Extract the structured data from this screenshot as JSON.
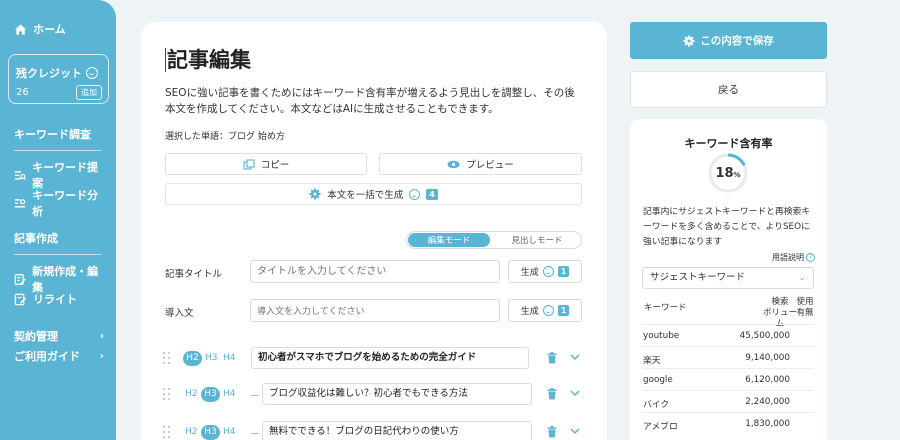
{
  "sidebar": {
    "home": "ホーム",
    "credit_title": "残クレジット",
    "credit_value": "26",
    "add_label": "追加",
    "section_keyword": "キーワード調査",
    "keyword_suggest": "キーワード提案",
    "keyword_analysis": "キーワード分析",
    "section_article": "記事作成",
    "new_edit": "新規作成・編集",
    "rewrite": "リライト",
    "contract": "契約管理",
    "guide": "ご利用ガイド"
  },
  "editor": {
    "title": "記事編集",
    "description": "SEOに強い記事を書くためにはキーワード含有率が増えるよう見出しを調整し、その後本文を作成してください。本文などはAIに生成させることもできます。",
    "selected_words": "選択した単語：ブログ 始め方",
    "copy_label": "コピー",
    "preview_label": "プレビュー",
    "generate_all_label": "本文を一括で生成",
    "generate_all_badge": "4",
    "mode_edit": "編集モード",
    "mode_heading": "見出しモード",
    "title_label": "記事タイトル",
    "title_placeholder": "タイトルを入力してください",
    "intro_label": "導入文",
    "intro_placeholder": "導入文を入力してください",
    "generate_label": "生成",
    "generate_badge": "1",
    "headings": [
      {
        "active": "H2",
        "text": "初心者がスマホでブログを始めるための完全ガイド"
      },
      {
        "active": "H3",
        "text": "ブログ収益化は難しい？初心者でもできる方法"
      },
      {
        "active": "H3",
        "text": "無料でできる！ブログの日記代わりの使い方"
      }
    ],
    "levels": [
      "H2",
      "H3",
      "H4"
    ]
  },
  "right": {
    "save_label": "この内容で保存",
    "back_label": "戻る",
    "panel_title": "キーワード含有率",
    "rate_value": "18",
    "rate_unit": "%",
    "rate_fraction": 0.18,
    "panel_desc": "記事内にサジェストキーワードと再検索キーワードを多く含めることで、よりSEOに強い記事になります",
    "help_label": "用語説明",
    "select_value": "サジェストキーワード",
    "col_keyword": "キーワード",
    "col_volume_1": "検索",
    "col_volume_2": "ボリューム",
    "col_used_1": "使用",
    "col_used_2": "有無",
    "keywords": [
      {
        "k": "youtube",
        "v": "45,500,000"
      },
      {
        "k": "楽天",
        "v": "9,140,000"
      },
      {
        "k": "google",
        "v": "6,120,000"
      },
      {
        "k": "バイク",
        "v": "2,240,000"
      },
      {
        "k": "アメブロ",
        "v": "1,830,000"
      }
    ]
  },
  "colors": {
    "accent": "#5ab4d4",
    "background": "#eef3f6"
  }
}
